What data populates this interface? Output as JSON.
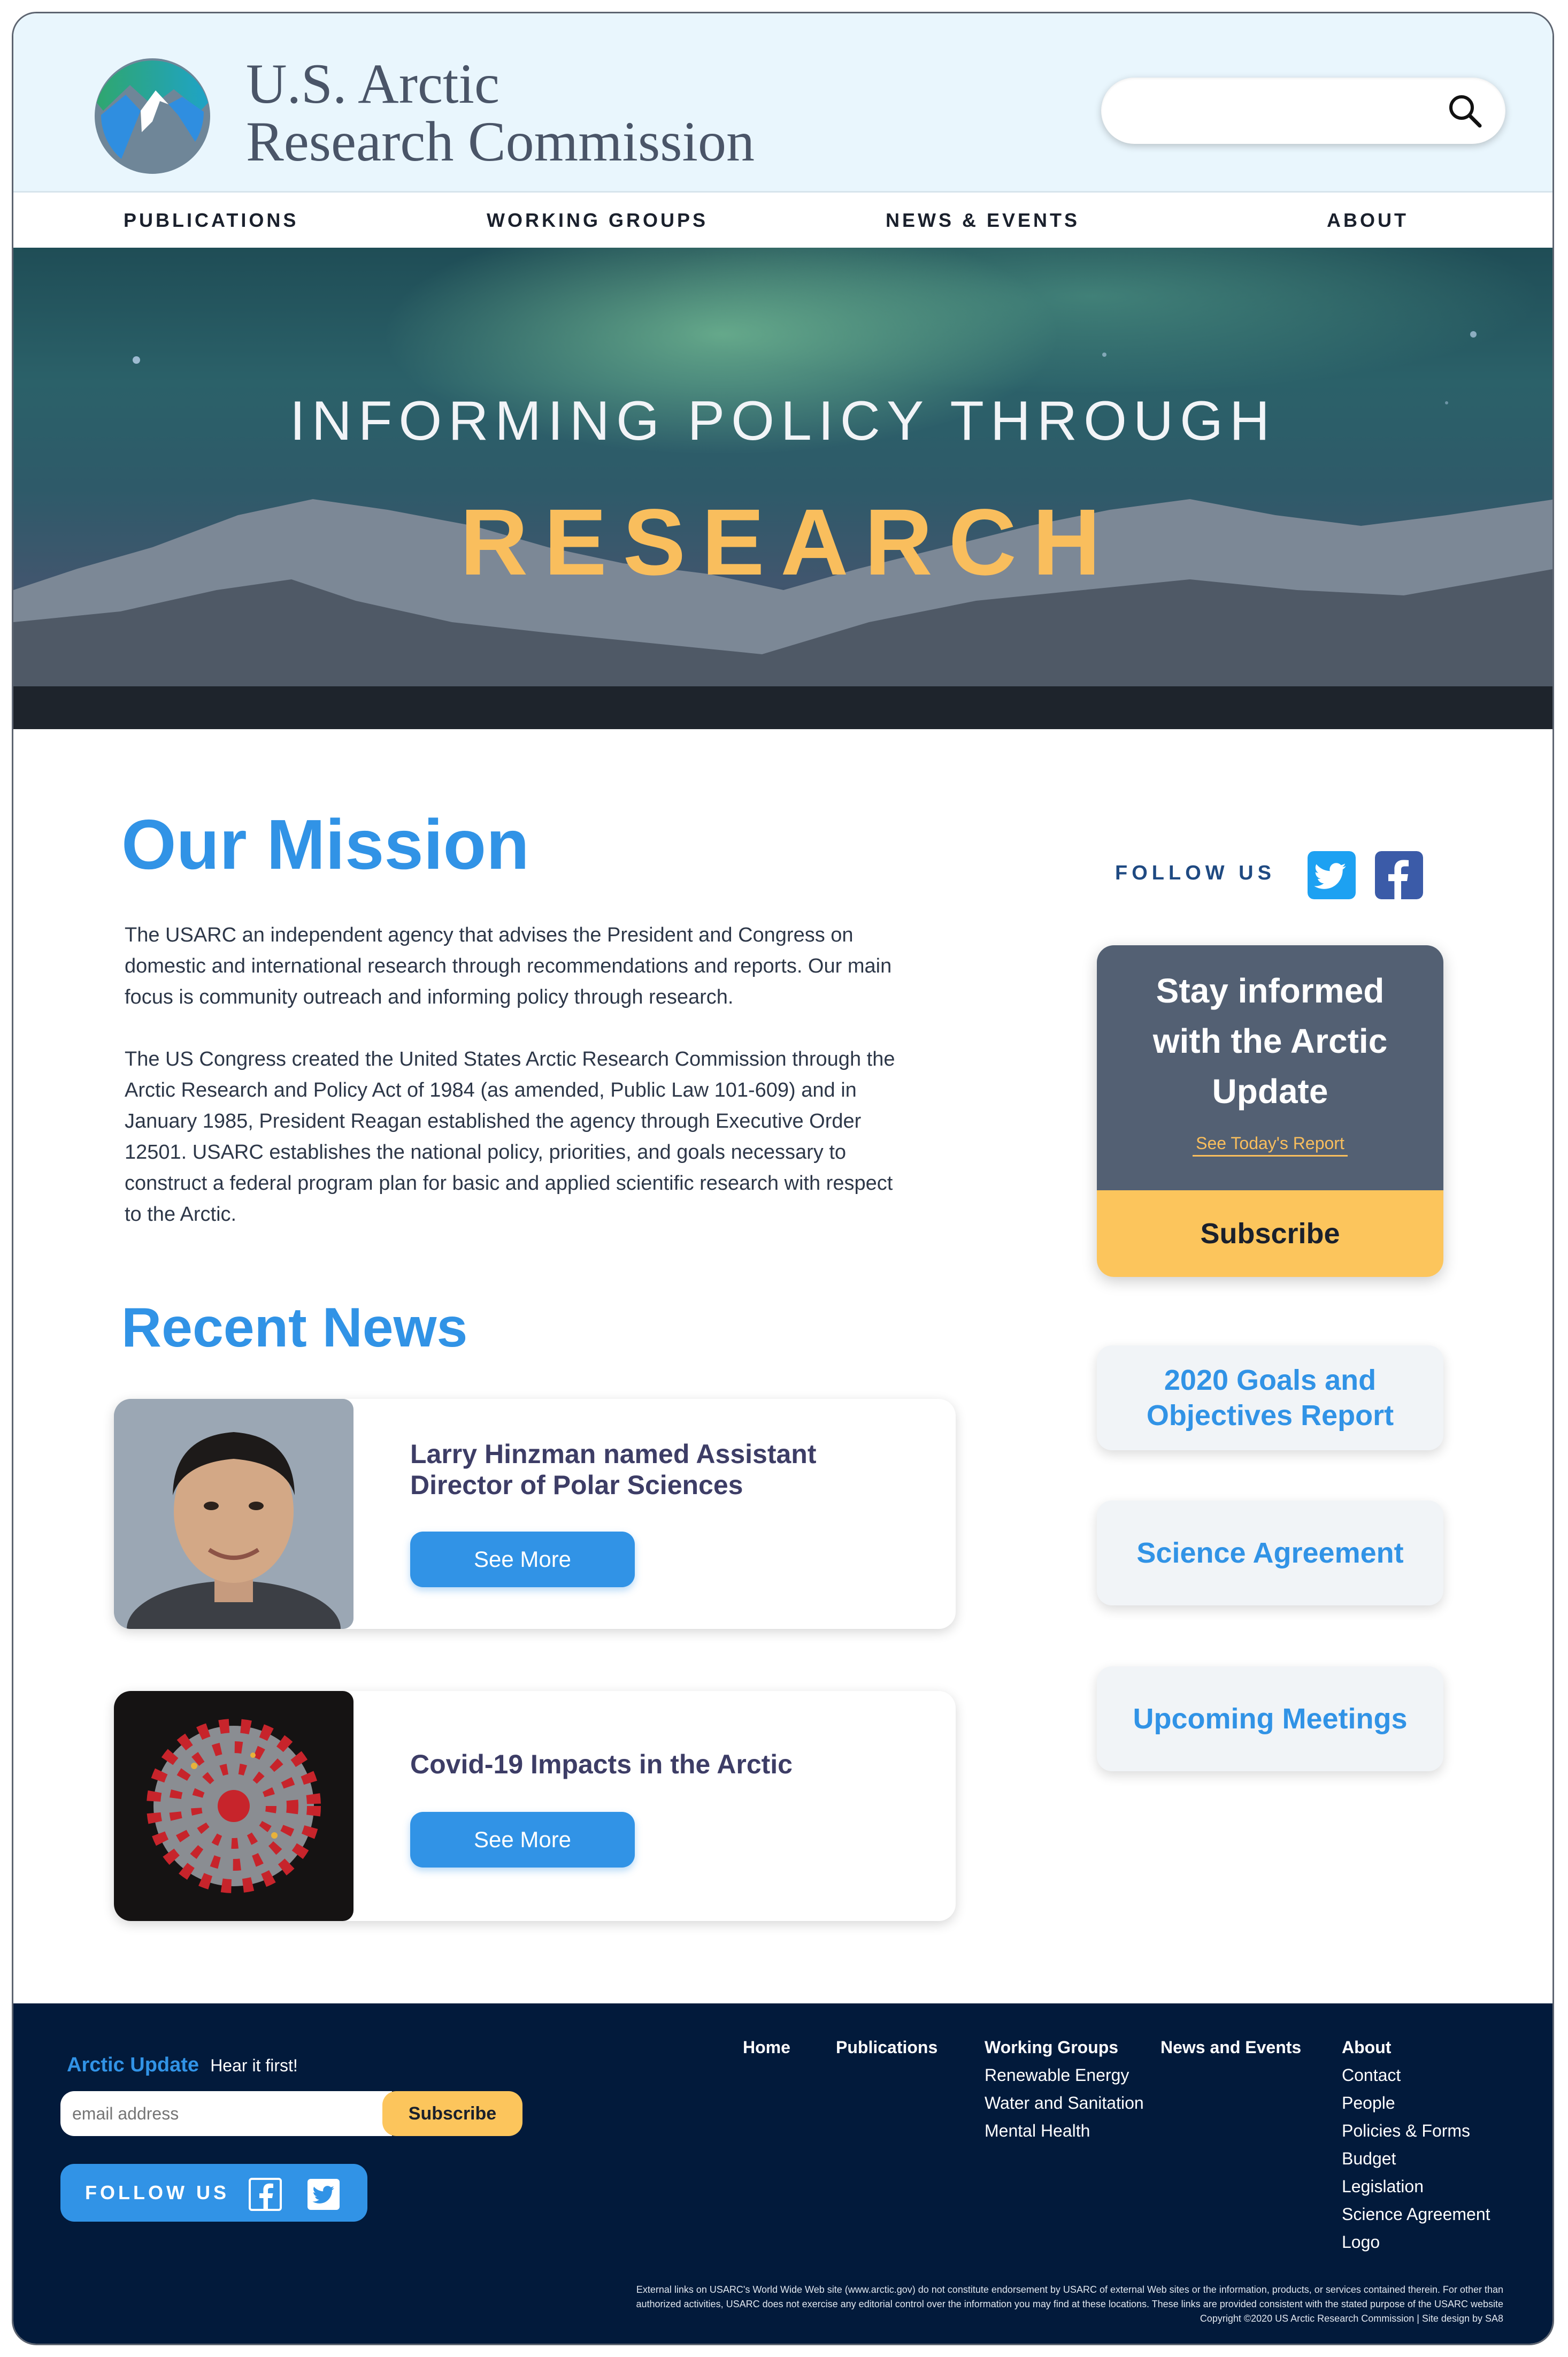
{
  "site": {
    "title_line1": "U.S. Arctic",
    "title_line2": "Research Commission",
    "search_placeholder": ""
  },
  "nav": {
    "items": [
      "PUBLICATIONS",
      "WORKING GROUPS",
      "NEWS & EVENTS",
      "ABOUT"
    ]
  },
  "hero": {
    "line1": "INFORMING POLICY THROUGH",
    "line2": "RESEARCH"
  },
  "mission": {
    "heading": "Our Mission",
    "paragraph1": "The USARC an independent agency that advises the President and Congress on domestic and international research through recommendations and reports. Our main focus is community outreach and informing policy through research.",
    "paragraph2": "The US Congress created the United States Arctic Research Commission through the Arctic Research and Policy Act of 1984 (as amended, Public Law 101-609) and in January 1985, President Reagan established the agency through Executive Order 12501. USARC establishes the national policy, priorities, and goals necessary to construct a federal program plan for basic and applied scientific research with respect to the Arctic."
  },
  "news": {
    "heading": "Recent News",
    "items": [
      {
        "title": "Larry Hinzman named Assistant Director of Polar Sciences",
        "button": "See More"
      },
      {
        "title": "Covid-19 Impacts in the Arctic",
        "button": "See More"
      }
    ]
  },
  "sidebar": {
    "follow_label": "FOLLOW US",
    "social_icons": [
      "twitter-icon",
      "facebook-icon"
    ],
    "arctic_update": {
      "heading": "Stay informed with the Arctic Update",
      "link": "See Today's Report",
      "button": "Subscribe"
    },
    "boxes": [
      "2020 Goals and Objectives Report",
      "Science Agreement",
      "Upcoming Meetings"
    ]
  },
  "footer": {
    "arctic_update_label": "Arctic Update",
    "arctic_update_tagline": "Hear it first!",
    "email_placeholder": "email address",
    "subscribe": "Subscribe",
    "follow_label": "FOLLOW US",
    "columns": [
      {
        "heading": "Home",
        "links": []
      },
      {
        "heading": "Publications",
        "links": []
      },
      {
        "heading": "Working Groups",
        "links": [
          "Renewable Energy",
          "Water and Sanitation",
          "Mental Health"
        ]
      },
      {
        "heading": "News and Events",
        "links": []
      },
      {
        "heading": "About",
        "links": [
          "Contact",
          "People",
          "Policies  & Forms",
          "Budget",
          "Legislation",
          "Science Agreement",
          "Logo"
        ]
      }
    ],
    "legal_line1": "External links on USARC's World Wide Web site (www.arctic.gov) do not constitute endorsement by USARC of external Web sites or the information, products, or services contained therein. For other than",
    "legal_line2": "authorized activities, USARC does not exercise any editorial control over the information you may find at these locations. These links are provided consistent with the stated purpose of the USARC website",
    "copyright": "Copyright ©2020 US Arctic Research Commission | Site design by SA8"
  },
  "colors": {
    "accent_blue": "#3193e6",
    "gold": "#f9be5d",
    "header_bg": "#e9f6fd",
    "footer_bg": "#021a3b",
    "card_slate": "#536073"
  }
}
